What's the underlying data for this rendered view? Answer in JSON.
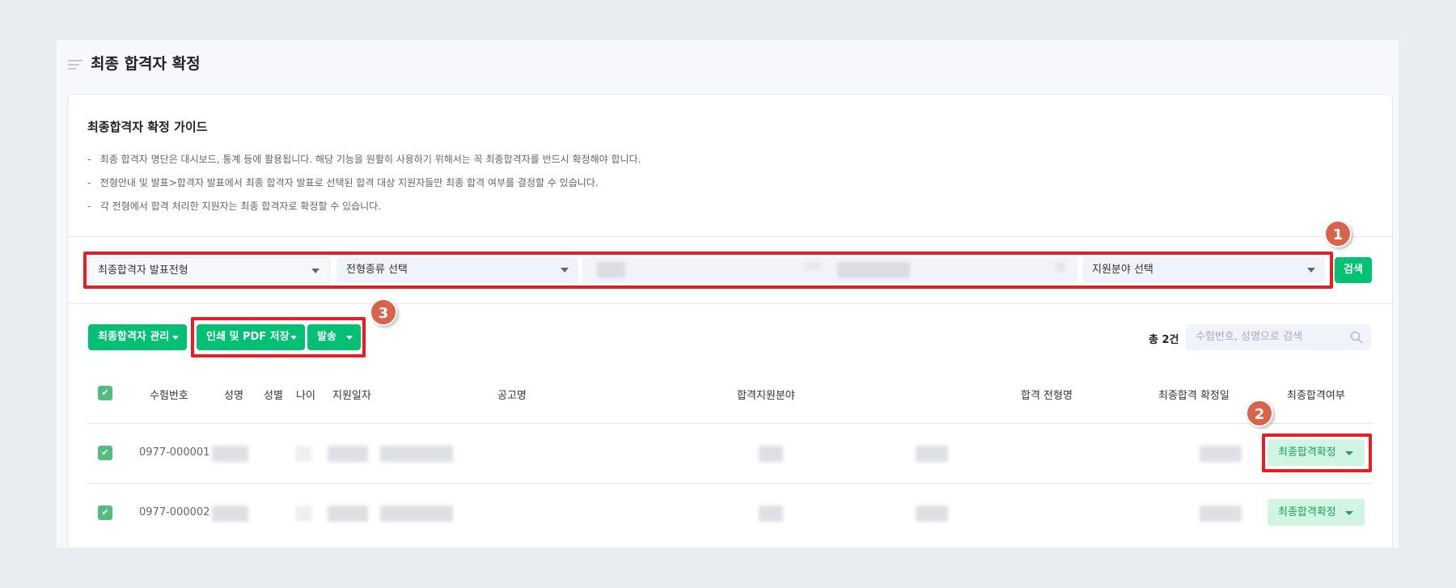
{
  "page": {
    "title": "최종 합격자 확정"
  },
  "guide": {
    "title": "최종합격자 확정 가이드",
    "bullets": [
      "최종 합격자 명단은 대시보드, 통계 등에 활용됩니다. 해당 기능을 원활히 사용하기 위해서는 꼭 최종합격자를 반드시 확정해야 합니다.",
      "전형안내 및 발표>합격자 발표에서 최종 합격자 발표로 선택된 합격 대상 지원자들만 최종 합격 여부를 결정할 수 있습니다.",
      "각 전형에서 합격 처리한 지원자는 최종 합격자로 확정할 수 있습니다."
    ]
  },
  "filters": {
    "select1": "최종합격자 발표전형",
    "select2": "전형종류 선택",
    "select4": "지원분야 선택",
    "search_button": "검색"
  },
  "toolbar": {
    "manage": "최종합격자 관리",
    "print": "인쇄 및 PDF 저장",
    "send": "발송",
    "total": "총 2건",
    "search_placeholder": "수험번호, 성명으로 검색"
  },
  "annotations": {
    "a1": "1",
    "a2": "2",
    "a3": "3"
  },
  "table": {
    "headers": [
      "수험번호",
      "성명",
      "성별",
      "나이",
      "지원일자",
      "공고명",
      "합격지원분야",
      "합격 전형명",
      "최종합격 확정일",
      "최종합격여부"
    ],
    "rows": [
      {
        "id": "0977-000001",
        "status": "최종합격확정"
      },
      {
        "id": "0977-000002",
        "status": "최종합격확정"
      }
    ]
  },
  "colors": {
    "accent": "#00c073",
    "highlight": "#ec1c24",
    "badge": "#d9624a"
  }
}
